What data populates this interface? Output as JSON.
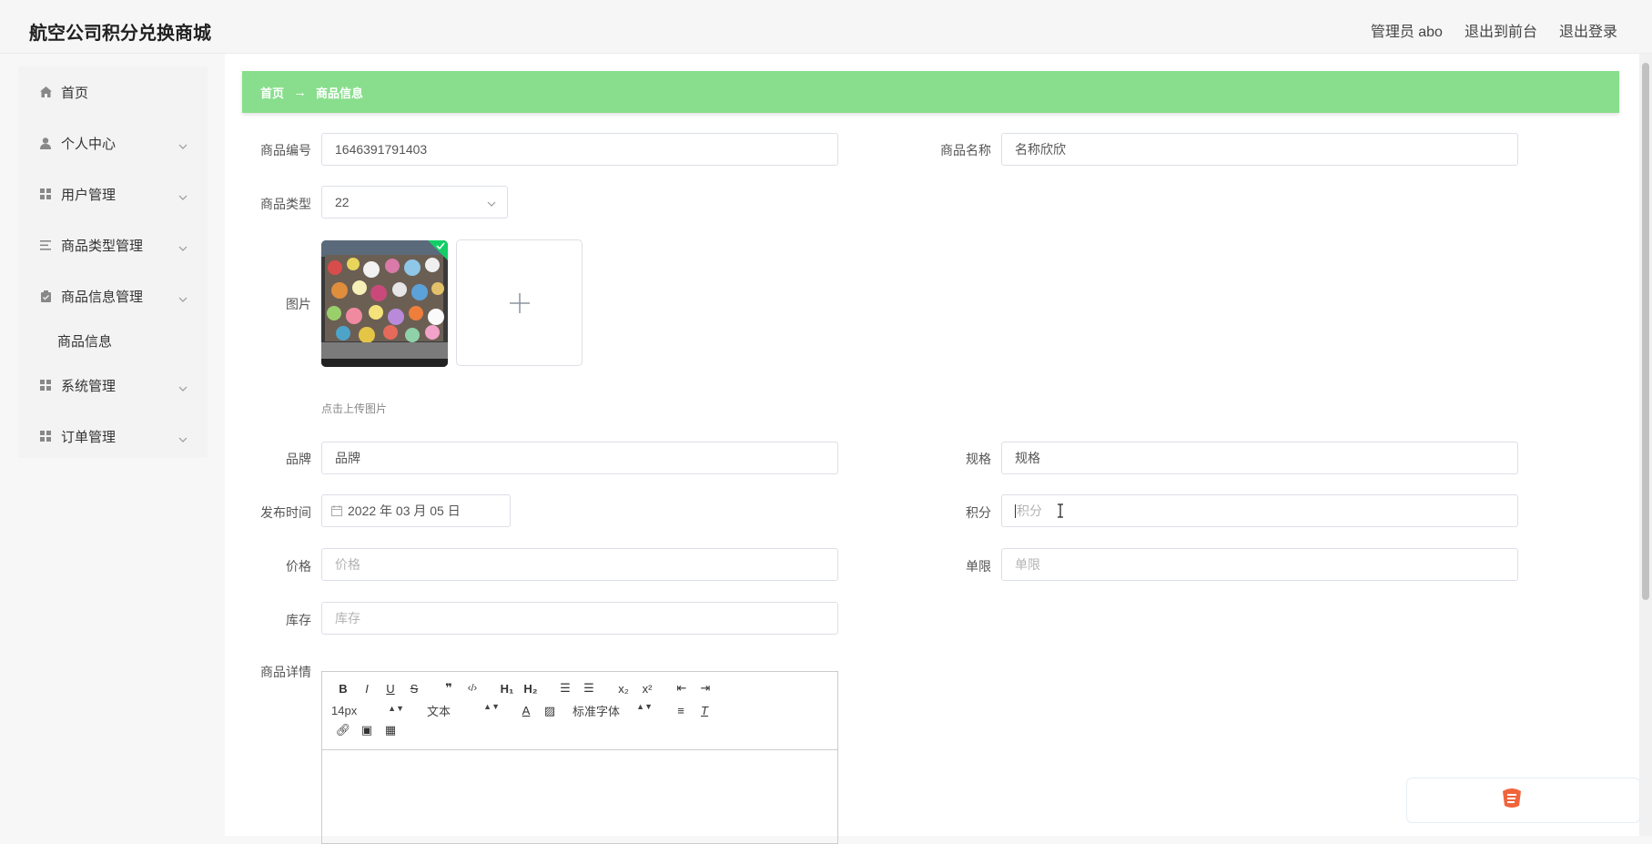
{
  "header": {
    "title": "航空公司积分兑换商城",
    "user_label": "管理员 abo",
    "to_front": "退出到前台",
    "logout": "退出登录"
  },
  "sidebar": {
    "items": [
      {
        "label": "首页",
        "icon": "home-icon"
      },
      {
        "label": "个人中心",
        "icon": "user-icon"
      },
      {
        "label": "用户管理",
        "icon": "grid-icon"
      },
      {
        "label": "商品类型管理",
        "icon": "list-icon"
      },
      {
        "label": "商品信息管理",
        "icon": "clipboard-icon"
      },
      {
        "label": "系统管理",
        "icon": "grid-icon"
      },
      {
        "label": "订单管理",
        "icon": "grid-icon"
      }
    ],
    "subitem": "商品信息"
  },
  "breadcrumb": {
    "home": "首页",
    "arrow": "→",
    "current": "商品信息"
  },
  "form": {
    "product_no": {
      "label": "商品编号",
      "value": "1646391791403"
    },
    "product_name": {
      "label": "商品名称",
      "value": "名称欣欣"
    },
    "product_type": {
      "label": "商品类型",
      "value": "22"
    },
    "image": {
      "label": "图片",
      "tip": "点击上传图片"
    },
    "brand": {
      "label": "品牌",
      "value": "品牌"
    },
    "spec": {
      "label": "规格",
      "value": "规格"
    },
    "publish_time": {
      "label": "发布时间",
      "value": "2022 年 03 月 05 日"
    },
    "points": {
      "label": "积分",
      "placeholder": "积分"
    },
    "price": {
      "label": "价格",
      "placeholder": "价格"
    },
    "limit": {
      "label": "单限",
      "placeholder": "单限"
    },
    "stock": {
      "label": "库存",
      "placeholder": "库存"
    },
    "detail": {
      "label": "商品详情"
    }
  },
  "editor": {
    "font_size": "14px",
    "paragraph": "文本",
    "font_family": "标准字体"
  },
  "colors": {
    "accent_green": "#88de8c",
    "check_green": "#13ce66"
  }
}
